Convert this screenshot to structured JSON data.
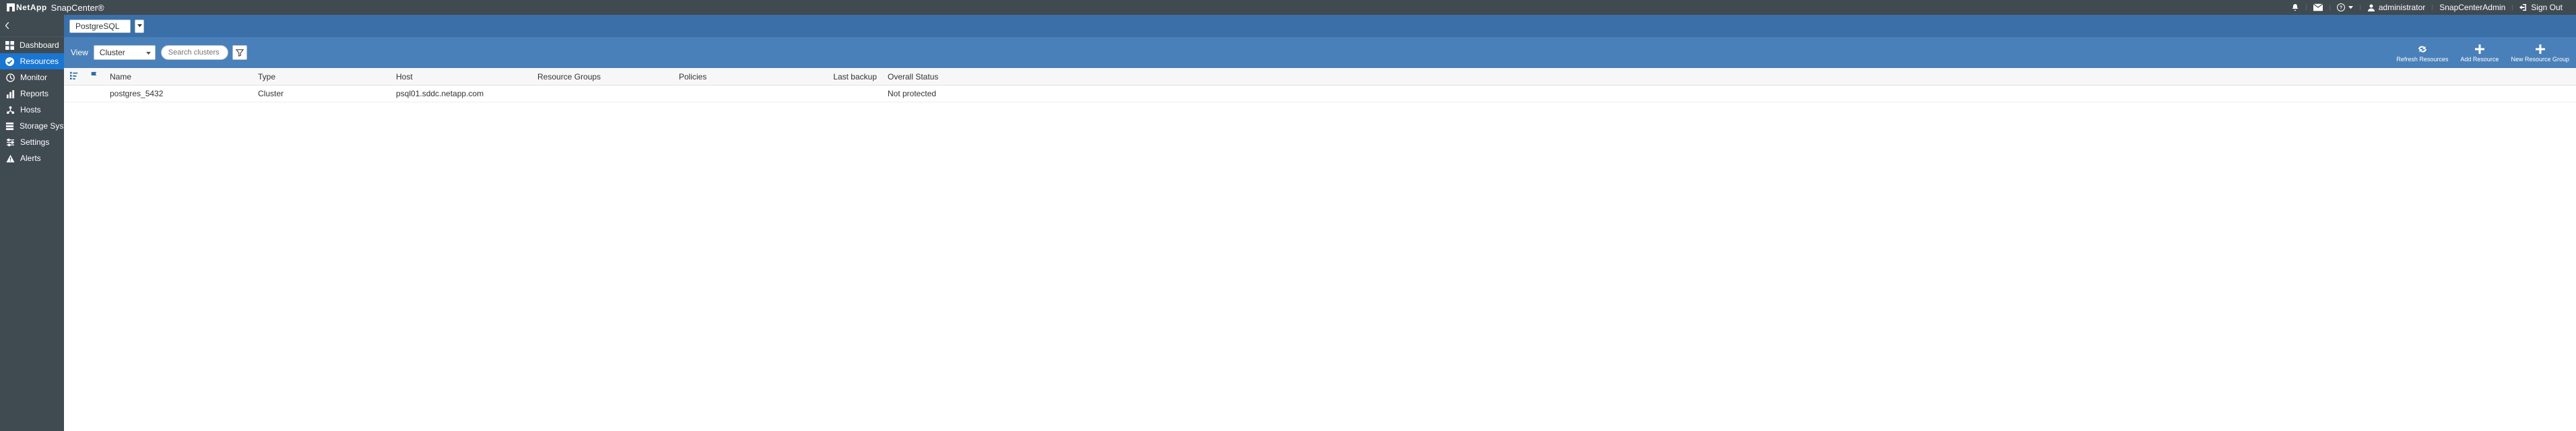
{
  "topbar": {
    "brand_company": "NetApp",
    "brand_product": "SnapCenter®",
    "user_label": "administrator",
    "role_label": "SnapCenterAdmin",
    "signout_label": "Sign Out"
  },
  "sidebar": {
    "items": [
      {
        "label": "Dashboard"
      },
      {
        "label": "Resources"
      },
      {
        "label": "Monitor"
      },
      {
        "label": "Reports"
      },
      {
        "label": "Hosts"
      },
      {
        "label": "Storage Systems"
      },
      {
        "label": "Settings"
      },
      {
        "label": "Alerts"
      }
    ]
  },
  "context": {
    "plugin": "PostgreSQL"
  },
  "toolbar": {
    "view_label": "View",
    "view_value": "Cluster",
    "search_placeholder": "Search clusters",
    "actions": {
      "refresh": "Refresh Resources",
      "add": "Add Resource",
      "newgroup": "New Resource Group"
    }
  },
  "table": {
    "headers": {
      "name": "Name",
      "type": "Type",
      "host": "Host",
      "resource_groups": "Resource Groups",
      "policies": "Policies",
      "last_backup": "Last backup",
      "overall_status": "Overall Status"
    },
    "rows": [
      {
        "name": "postgres_5432",
        "type": "Cluster",
        "host": "psql01.sddc.netapp.com",
        "resource_groups": "",
        "policies": "",
        "last_backup": "",
        "overall_status": "Not protected"
      }
    ]
  }
}
